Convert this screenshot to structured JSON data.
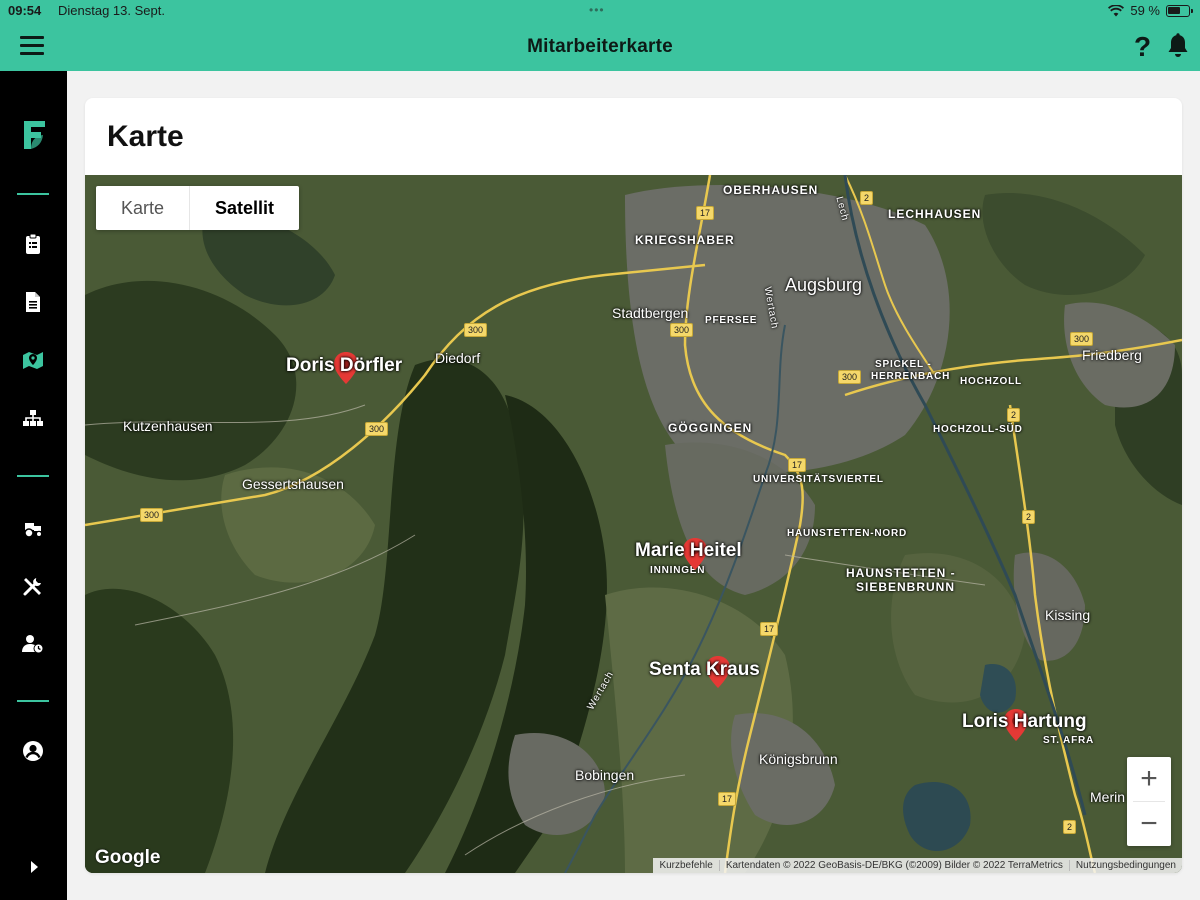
{
  "status_bar": {
    "time": "09:54",
    "date": "Dienstag 13. Sept.",
    "battery": "59 %"
  },
  "header": {
    "title": "Mitarbeiterkarte",
    "help_label": "?",
    "accent_color": "#3cc49f"
  },
  "sidebar": {
    "items": [
      {
        "icon": "clipboard-icon",
        "active": false
      },
      {
        "icon": "document-icon",
        "active": false
      },
      {
        "icon": "map-pin-icon",
        "active": true
      },
      {
        "icon": "org-chart-icon",
        "active": false
      },
      {
        "icon": "tractor-icon",
        "active": false
      },
      {
        "icon": "tools-icon",
        "active": false
      },
      {
        "icon": "user-clock-icon",
        "active": false
      },
      {
        "icon": "user-circle-icon",
        "active": false
      }
    ]
  },
  "card": {
    "title": "Karte"
  },
  "map": {
    "type_buttons": {
      "map": "Karte",
      "satellite": "Satellit"
    },
    "selected_type": "Satellit",
    "places": {
      "oberhausen": "OBERHAUSEN",
      "lechhausen": "LECHHAUSEN",
      "kriegshaber": "KRIEGSHABER",
      "augsburg": "Augsburg",
      "stadtbergen": "Stadtbergen",
      "pfersee": "PFERSEE",
      "diedorf": "Diedorf",
      "friedberg": "Friedberg",
      "spickel": "SPICKEL -",
      "herrenbach": "HERRENBACH",
      "hochzoll": "HOCHZOLL",
      "hochzoll_sued": "HOCHZOLL-SÜD",
      "kutzenhausen": "Kutzenhausen",
      "goeggingen": "GÖGGINGEN",
      "gessertshausen": "Gessertshausen",
      "universitaetsviertel": "UNIVERSITÄTSVIERTEL",
      "haunstetten_nord": "HAUNSTETTEN-NORD",
      "inningen": "INNINGEN",
      "haunstetten_sieben_1": "HAUNSTETTEN -",
      "haunstetten_sieben_2": "SIEBENBRUNN",
      "kissing": "Kissing",
      "st_afra": "ST. AFRA",
      "bobingen": "Bobingen",
      "koenigsbrunn": "Königsbrunn",
      "mering": "Merin",
      "wertach": "Wertach",
      "wertach2": "Wertach",
      "lech": "Lech"
    },
    "road_numbers": {
      "b17": "17",
      "b300": "300",
      "b2": "2"
    },
    "employees": [
      {
        "name": "Doris Dörfler"
      },
      {
        "name": "Marie Heitel"
      },
      {
        "name": "Senta Kraus"
      },
      {
        "name": "Loris Hartung"
      }
    ],
    "pin_color": "#e53935",
    "zoom_in": "+",
    "zoom_out": "−",
    "logo": "Google",
    "attribution": {
      "shortcuts": "Kurzbefehle",
      "data": "Kartendaten © 2022 GeoBasis-DE/BKG (©2009) Bilder © 2022 TerraMetrics",
      "terms": "Nutzungsbedingungen"
    }
  }
}
